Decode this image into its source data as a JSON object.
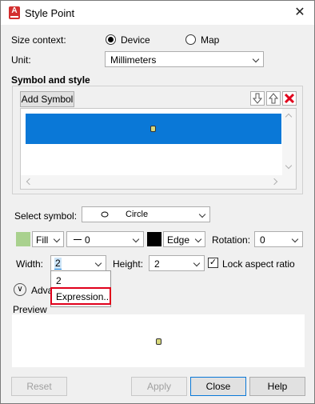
{
  "window": {
    "title": "Style Point",
    "app_icon_letter": "A"
  },
  "size_context": {
    "label": "Size context:",
    "options": [
      "Device",
      "Map"
    ],
    "selected": "Device"
  },
  "unit": {
    "label": "Unit:",
    "value": "Millimeters"
  },
  "symbol_style": {
    "heading": "Symbol and style",
    "add_symbol_label": "Add Symbol",
    "toolbar_icons": [
      "arrow-down-icon",
      "arrow-up-icon",
      "delete-x-icon"
    ]
  },
  "select_symbol": {
    "label": "Select symbol:",
    "value": "Circle"
  },
  "fill": {
    "label": "Fill",
    "color": "#a9d18e"
  },
  "line": {
    "value": "0"
  },
  "edge": {
    "label": "Edge",
    "color": "#000000"
  },
  "rotation": {
    "label": "Rotation:",
    "value": "0"
  },
  "width": {
    "label": "Width:",
    "value": "2",
    "dropdown_options": [
      "2",
      "Expression..."
    ]
  },
  "height": {
    "label": "Height:",
    "value": "2"
  },
  "lock_aspect": {
    "label": "Lock aspect ratio",
    "checked": true
  },
  "advanced": {
    "label": "Adva"
  },
  "preview": {
    "label": "Preview"
  },
  "buttons": {
    "reset": "Reset",
    "apply": "Apply",
    "close": "Close",
    "help": "Help"
  },
  "colors": {
    "selection": "#0a78d7",
    "highlight_outline": "#e0001b",
    "point_fill": "#d7d77a"
  }
}
